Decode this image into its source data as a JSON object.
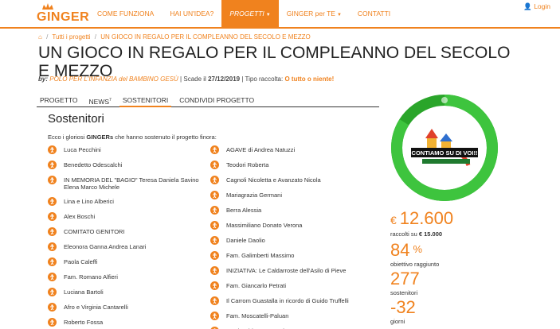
{
  "brand": {
    "logo_text": "GINGER"
  },
  "nav": {
    "items": [
      {
        "label": "COME FUNZIONA",
        "active": false,
        "caret": false
      },
      {
        "label": "HAI UN'IDEA?",
        "active": false,
        "caret": false
      },
      {
        "label": "PROGETTI",
        "active": true,
        "caret": true
      },
      {
        "label": "GINGER per TE",
        "active": false,
        "caret": true
      },
      {
        "label": "CONTATTI",
        "active": false,
        "caret": false
      }
    ],
    "login_label": "Login"
  },
  "breadcrumb": {
    "items": [
      "Tutti i progetti",
      "UN GIOCO IN REGALO PER IL COMPLEANNO DEL SECOLO E MEZZO"
    ]
  },
  "project": {
    "title": "UN GIOCO IN REGALO PER IL COMPLEANNO DEL SECOLO E MEZZO",
    "by_label": "by:",
    "organization": "POLO PER L'INFANZIA del BAMBINO GESÙ",
    "deadline_label": "Scade il",
    "deadline": "27/12/2019",
    "type_label": "Tipo raccolta:",
    "type_value": "O tutto o niente!"
  },
  "tabs": [
    {
      "label": "PROGETTO",
      "active": false,
      "sup": ""
    },
    {
      "label": "NEWS",
      "active": false,
      "sup": "7"
    },
    {
      "label": "SOSTENITORI",
      "active": true,
      "sup": ""
    },
    {
      "label": "CONDIVIDI PROGETTO",
      "active": false,
      "sup": ""
    }
  ],
  "supporters": {
    "heading": "Sostenitori",
    "intro_before": "Ecco i gloriosi ",
    "intro_bold": "GINGERs",
    "intro_after": " che hanno sostenuto il progetto finora:",
    "left": [
      {
        "name": "Luca Pecchini"
      },
      {
        "name": "Benedetto Odescalchi"
      },
      {
        "name": "IN MEMORIA DEL \"BAGIO\" Teresa Daniela Savino Elena Marco Michele"
      },
      {
        "name": "Lina e Lino Alberici"
      },
      {
        "name": "Alex Boschi"
      },
      {
        "name": "COMITATO GENITORI"
      },
      {
        "name": "Eleonora Ganna Andrea Lanari"
      },
      {
        "name": "Paola Caleffi"
      },
      {
        "name": "Fam. Romano Alfieri"
      },
      {
        "name": "Luciana Bartoli"
      },
      {
        "name": "Afro e Virginia Cantarelli"
      },
      {
        "name": "Roberto Fossa"
      }
    ],
    "right": [
      {
        "name": "AGAVE di Andrea Natuzzi"
      },
      {
        "name": "Teodori Roberta"
      },
      {
        "name": "Cagnoli Nicoletta e Avanzato Nicola"
      },
      {
        "name": "Mariagrazia Germani"
      },
      {
        "name": "Berra Alessia"
      },
      {
        "name": "Massimiliano Donato Verona"
      },
      {
        "name": "Daniele Daolio"
      },
      {
        "name": "Fam. Galimberti Massimo"
      },
      {
        "name": "INIZIATIVA: Le Caldarroste dell'Asilo di Pieve"
      },
      {
        "name": "Fam. Giancarlo Petrati"
      },
      {
        "name": "Il Carrom Guastalla in ricordo di Guido Truffelli"
      },
      {
        "name": "Fam. Moscatelli-Paluan"
      },
      {
        "name": "Mattia Chiara Savazzi"
      }
    ]
  },
  "campaign": {
    "banner_text": "CONTIAMO SU DI VOI!!",
    "progress_fraction": 0.84,
    "raised_currency": "€",
    "raised": "12.600",
    "raised_caption_before": "raccolti su ",
    "raised_goal": "€ 15.000",
    "percent": "84",
    "percent_unit": "%",
    "percent_caption": "obiettivo raggiunto",
    "supporters_count": "277",
    "supporters_caption": "sostenitori",
    "days": "-32",
    "days_caption": "giorni"
  },
  "colors": {
    "accent": "#f0821e",
    "ring": "#3ec43e",
    "ring_track": "#2aa52a"
  }
}
